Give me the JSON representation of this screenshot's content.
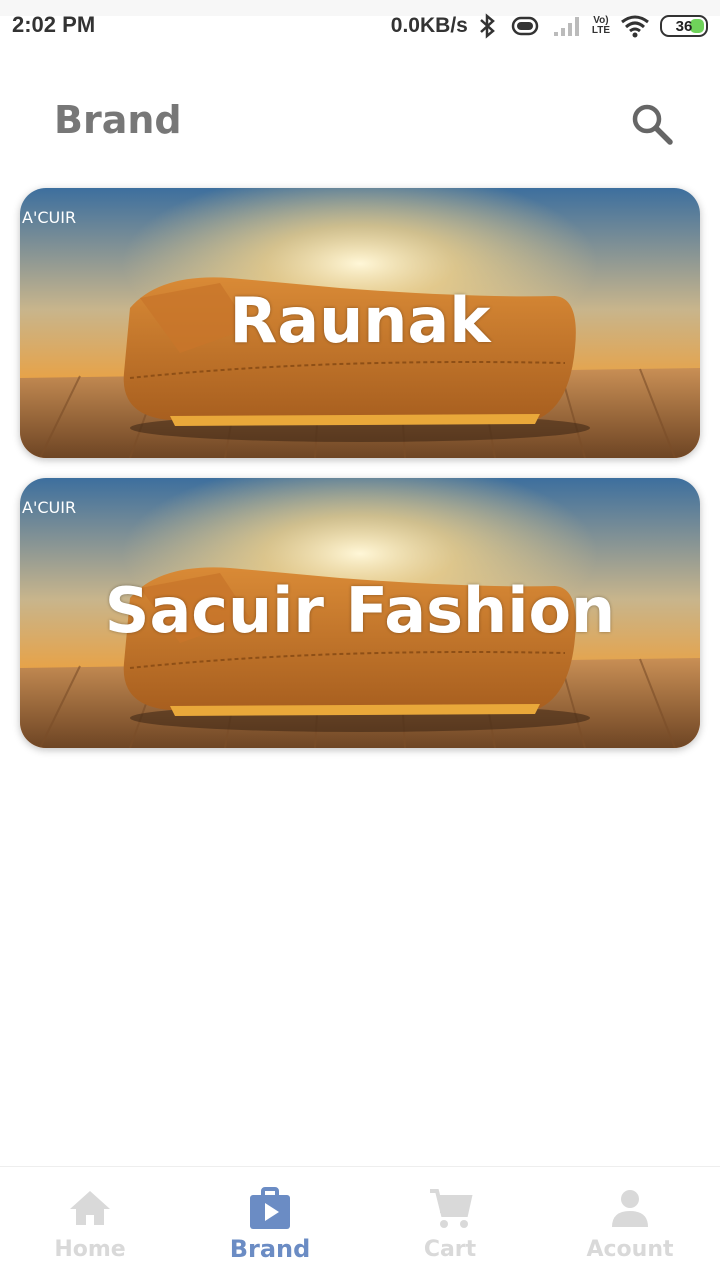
{
  "status_bar": {
    "time": "2:02 PM",
    "net_speed": "0.0KB/s",
    "lte_top": "Vo)",
    "lte_bottom": "LTE",
    "battery": "36",
    "battery_color": "#6fd35a"
  },
  "header": {
    "title": "Brand",
    "search_icon": "search-icon"
  },
  "brands": [
    {
      "name": "Raunak",
      "logo_text": "A'CUIR"
    },
    {
      "name": "Sacuir Fashion",
      "logo_text": "A'CUIR"
    }
  ],
  "bottom_nav": {
    "items": [
      {
        "label": "Home",
        "icon": "home-icon",
        "active": false
      },
      {
        "label": "Brand",
        "icon": "brand-icon",
        "active": true
      },
      {
        "label": "Cart",
        "icon": "cart-icon",
        "active": false
      },
      {
        "label": "Acount",
        "icon": "account-icon",
        "active": false
      }
    ],
    "active_color": "#6b8cc4",
    "inactive_color": "#d9d9d9"
  }
}
